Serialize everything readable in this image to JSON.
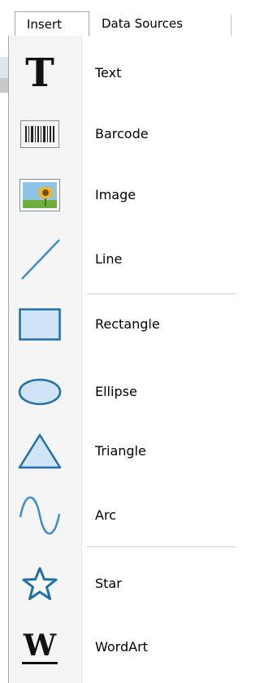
{
  "tabs": [
    {
      "label": "Insert",
      "active": true
    },
    {
      "label": "Data Sources",
      "active": false
    }
  ],
  "items": [
    {
      "label": "Text",
      "icon": "text-t-icon"
    },
    {
      "label": "Barcode",
      "icon": "barcode-icon"
    },
    {
      "label": "Image",
      "icon": "image-icon"
    },
    {
      "label": "Line",
      "icon": "line-icon"
    },
    {
      "label": "Rectangle",
      "icon": "rectangle-icon"
    },
    {
      "label": "Ellipse",
      "icon": "ellipse-icon"
    },
    {
      "label": "Triangle",
      "icon": "triangle-icon"
    },
    {
      "label": "Arc",
      "icon": "arc-icon"
    },
    {
      "label": "Star",
      "icon": "star-icon"
    },
    {
      "label": "WordArt",
      "icon": "wordart-icon"
    }
  ],
  "icon_text": {
    "text_glyph": "T",
    "wordart_glyph": "W"
  },
  "colors": {
    "shape_fill": "#cfe5f7",
    "shape_stroke": "#1f6fa8",
    "line_stroke": "#3c8fca"
  }
}
